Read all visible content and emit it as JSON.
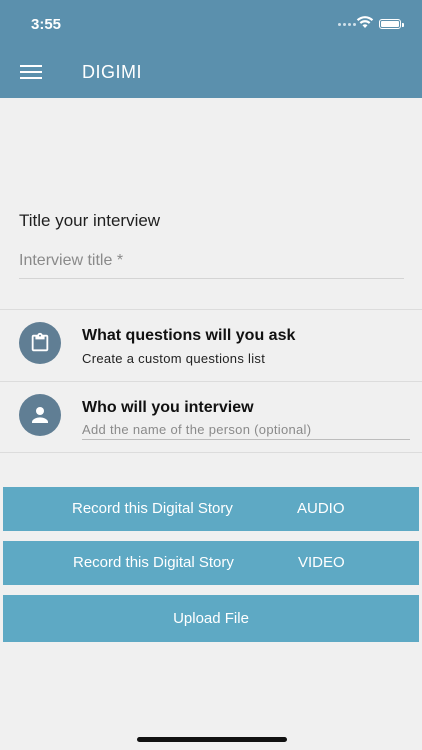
{
  "status_bar": {
    "time": "3:55"
  },
  "header": {
    "title": "DIGIMI",
    "menu_icon": "hamburger-menu-icon"
  },
  "interview": {
    "section_title": "Title your interview",
    "title_placeholder": "Interview title *",
    "title_value": ""
  },
  "questions": {
    "heading": "What questions will you ask",
    "subtitle": "Create a custom questions list",
    "icon": "clipboard-icon"
  },
  "interviewee": {
    "heading": "Who will you interview",
    "placeholder": "Add the name of the person (optional)",
    "icon": "person-icon"
  },
  "buttons": {
    "audio": {
      "label": "Record this Digital Story",
      "type": "AUDIO"
    },
    "video": {
      "label": "Record this Digital Story",
      "type": "VIDEO"
    },
    "upload": {
      "label": "Upload File"
    }
  },
  "colors": {
    "header": "#5b90ad",
    "button": "#5ea9c4",
    "icon_circle": "#607e94",
    "background": "#f0f0f0"
  }
}
